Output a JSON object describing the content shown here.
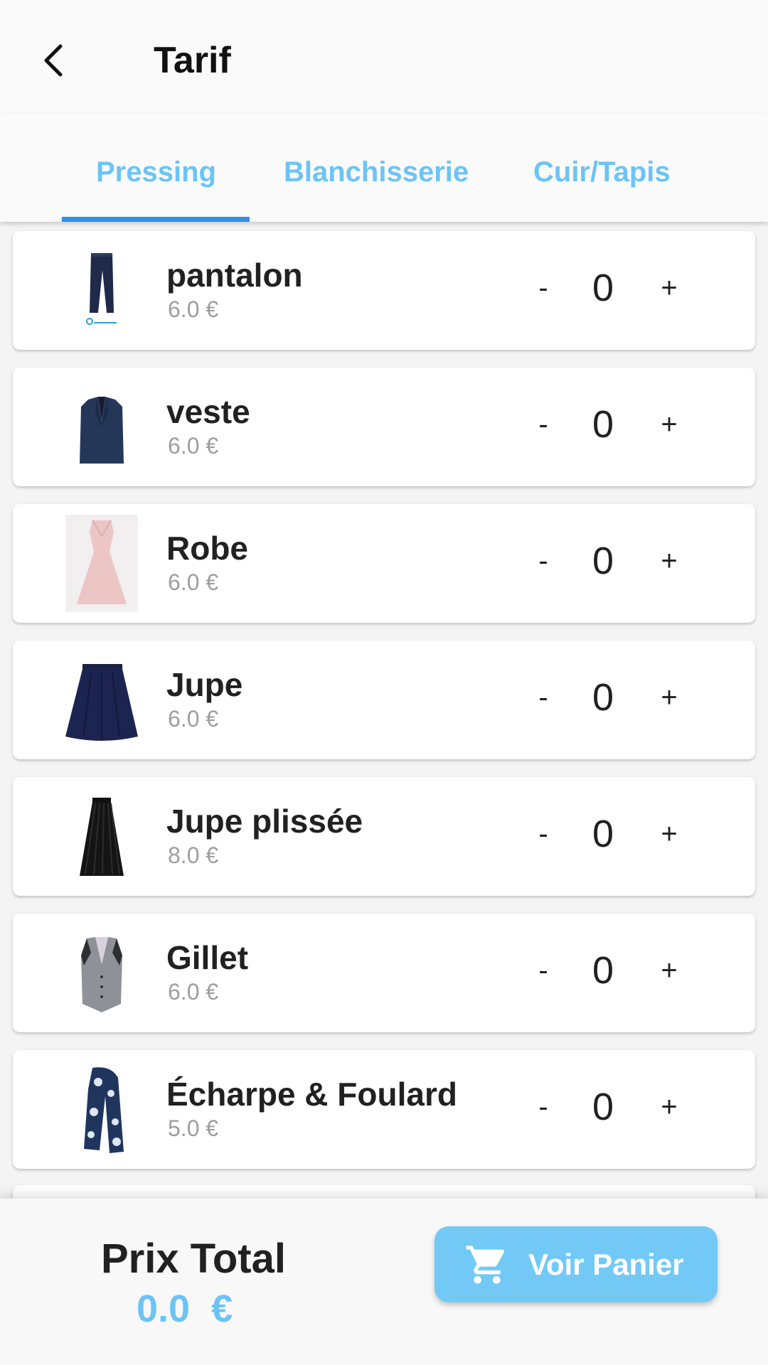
{
  "header": {
    "title": "Tarif",
    "back_icon": "chevron-left-icon"
  },
  "tabs": [
    {
      "label": "Pressing",
      "active": true
    },
    {
      "label": "Blanchisserie",
      "active": false
    },
    {
      "label": "Cuir/Tapis",
      "active": false
    }
  ],
  "colors": {
    "accent": "#6cc4f5",
    "tab_indicator": "#2f8ee6",
    "button": "#73c9f6"
  },
  "items": [
    {
      "name": "pantalon",
      "price": "6.0 €",
      "qty_minus": "-",
      "qty": "0",
      "qty_plus": "+",
      "icon": "pants-image"
    },
    {
      "name": "veste",
      "price": "6.0 €",
      "qty_minus": "-",
      "qty": "0",
      "qty_plus": "+",
      "icon": "jacket-image"
    },
    {
      "name": "Robe",
      "price": "6.0 €",
      "qty_minus": "-",
      "qty": "0",
      "qty_plus": "+",
      "icon": "dress-image"
    },
    {
      "name": "Jupe",
      "price": "6.0 €",
      "qty_minus": "-",
      "qty": "0",
      "qty_plus": "+",
      "icon": "skirt-image"
    },
    {
      "name": "Jupe plissée",
      "price": "8.0 €",
      "qty_minus": "-",
      "qty": "0",
      "qty_plus": "+",
      "icon": "pleated-skirt-image"
    },
    {
      "name": "Gillet",
      "price": "6.0 €",
      "qty_minus": "-",
      "qty": "0",
      "qty_plus": "+",
      "icon": "vest-image"
    },
    {
      "name": "Écharpe & Foulard",
      "price": "5.0 €",
      "qty_minus": "-",
      "qty": "0",
      "qty_plus": "+",
      "icon": "scarf-image"
    }
  ],
  "footer": {
    "total_label": "Prix Total",
    "total_value": "0.0  €",
    "cart_button_label": "Voir Panier",
    "cart_icon": "cart-icon"
  }
}
